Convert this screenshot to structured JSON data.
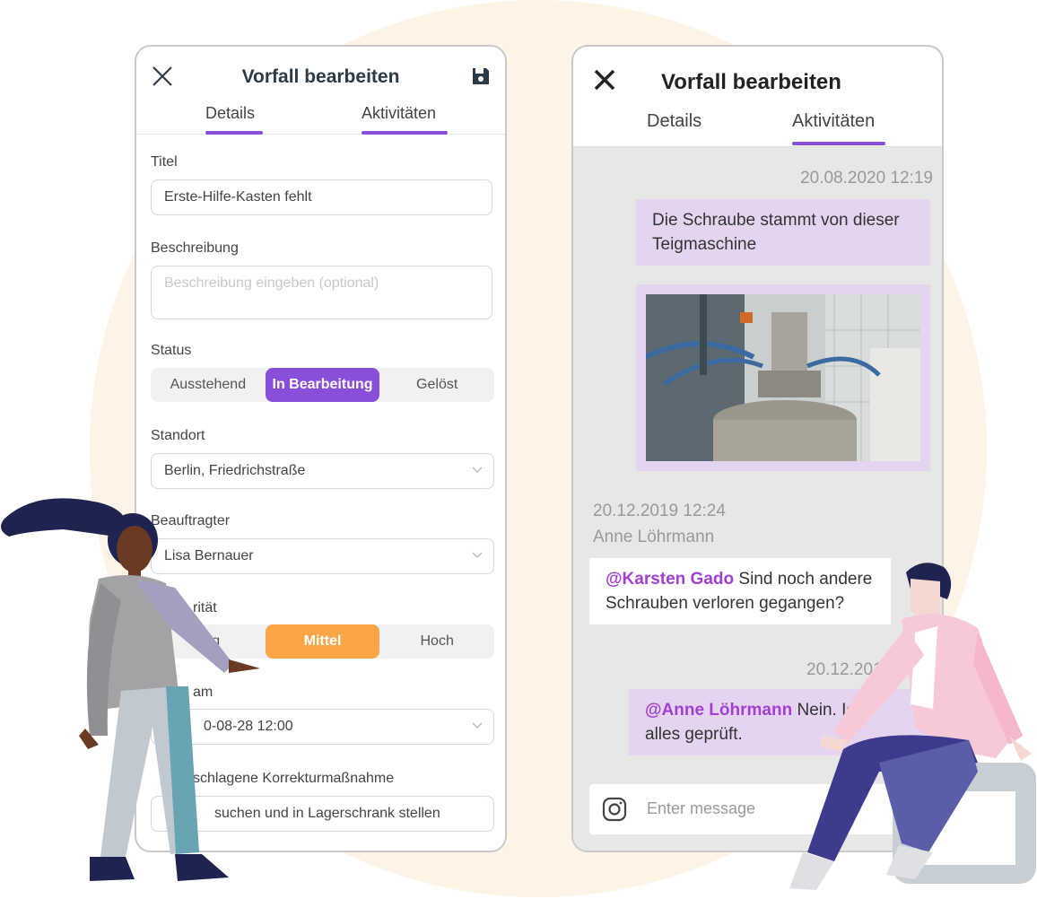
{
  "left_screen": {
    "title": "Vorfall bearbeiten",
    "tabs": [
      "Details",
      "Aktivitäten"
    ],
    "fields": {
      "titel_label": "Titel",
      "titel_value": "Erste-Hilfe-Kasten fehlt",
      "beschreibung_label": "Beschreibung",
      "beschreibung_placeholder": "Beschreibung eingeben (optional)",
      "status_label": "Status",
      "status_options": [
        "Ausstehend",
        "In Bearbeitung",
        "Gelöst"
      ],
      "status_selected": "In Bearbeitung",
      "standort_label": "Standort",
      "standort_value": "Berlin, Friedrichstraße",
      "beauftragter_label": "Beauftragter",
      "beauftragter_value": "Lisa Bernauer",
      "prioritaet_label": "rität",
      "prioritaet_options": [
        "drig",
        "Mittel",
        "Hoch"
      ],
      "prioritaet_selected": "Mittel",
      "faellig_label": "am",
      "faellig_value": "0-08-28 12:00",
      "korrektur_label": "schlagene Korrekturmaßnahme",
      "korrektur_value": "suchen und in Lagerschrank stellen"
    }
  },
  "right_screen": {
    "title": "Vorfall bearbeiten",
    "tabs": [
      "Details",
      "Aktivitäten"
    ],
    "messages": [
      {
        "timestamp": "20.08.2020 12:19",
        "text": "Die Schraube stammt von dieser Teigmaschine"
      },
      {
        "timestamp": "20.12.2019 12:24",
        "author": "Anne Löhrmann",
        "mention": "@Karsten Gado",
        "text": "Sind noch andere Schrauben verloren gegangen?"
      },
      {
        "timestamp": "20.12.2019 1",
        "mention": "@Anne Löhrmann",
        "text_a": "Nein. Ich",
        "text_b": "alles geprüft."
      }
    ],
    "input_placeholder": "Enter message"
  },
  "colors": {
    "accent": "#8a4fd8",
    "orange": "#f9a548",
    "bubble": "#e5d4ef",
    "mention": "#a23ed4"
  },
  "icons": [
    "close-icon",
    "save-icon",
    "chevron-down-icon",
    "camera-icon"
  ]
}
